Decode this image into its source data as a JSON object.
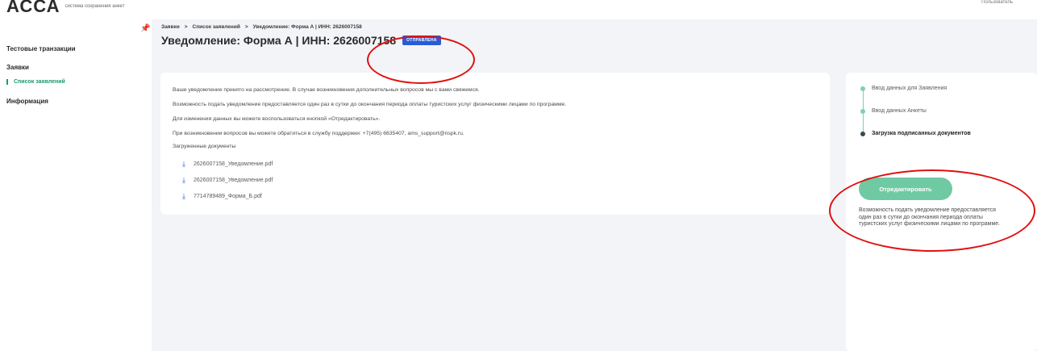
{
  "header": {
    "logo": "АССА",
    "logo_sub_1": "система сохранения анкет",
    "user_role": "Пользователь"
  },
  "sidebar": {
    "items": [
      {
        "label": "Тестовые транзакции"
      },
      {
        "label": "Заявки"
      },
      {
        "label": "Список заявлений"
      },
      {
        "label": "Информация"
      }
    ]
  },
  "breadcrumb": [
    "Заявки",
    "Список заявлений",
    "Уведомление: Форма А | ИНН: 2626007158"
  ],
  "breadcrumb_sep": ">",
  "page": {
    "title": "Уведомление: Форма А | ИНН: 2626007158",
    "status_badge": "ОТПРАВЛЕНА"
  },
  "messages": [
    "Ваше уведомление принято на рассмотрение. В случае возникновения дополнительных вопросов мы с вами свяжемся.",
    "Возможность подать уведомление предоставляется один раз в сутки до окончания периода оплаты туристских услуг физическими лицами по программе.",
    "Для изменения данных вы можете воспользоваться кнопкой «Отредактировать».",
    "При возникновении вопросов вы можете обратиться в службу поддержки: +7(495) 6635407, ams_support@nspk.ru.",
    "Загруженные документы"
  ],
  "documents": [
    {
      "name": "2626007158_Уведомление.pdf",
      "icon": "download-icon"
    },
    {
      "name": "2626007158_Уведомление.pdf",
      "icon": "download-icon"
    },
    {
      "name": "7714789489_Форма_Б.pdf",
      "icon": "download-icon"
    }
  ],
  "steps": [
    {
      "label": "Ввод данных для Заявления"
    },
    {
      "label": "Ввод данных Анкеты"
    },
    {
      "label": "Загрузка подписанных документов"
    }
  ],
  "actions": {
    "edit_label": "Отредактировать"
  },
  "note": "Возможность подать уведомление предоставляется один раз в сутки до окончания периода оплаты туристских услуг физическими лицами по программе.",
  "colors": {
    "accent_green": "#1a9a6e",
    "button_green": "#6fcaa3",
    "badge_blue": "#2a5bd7",
    "annotation_red": "#e01010"
  }
}
